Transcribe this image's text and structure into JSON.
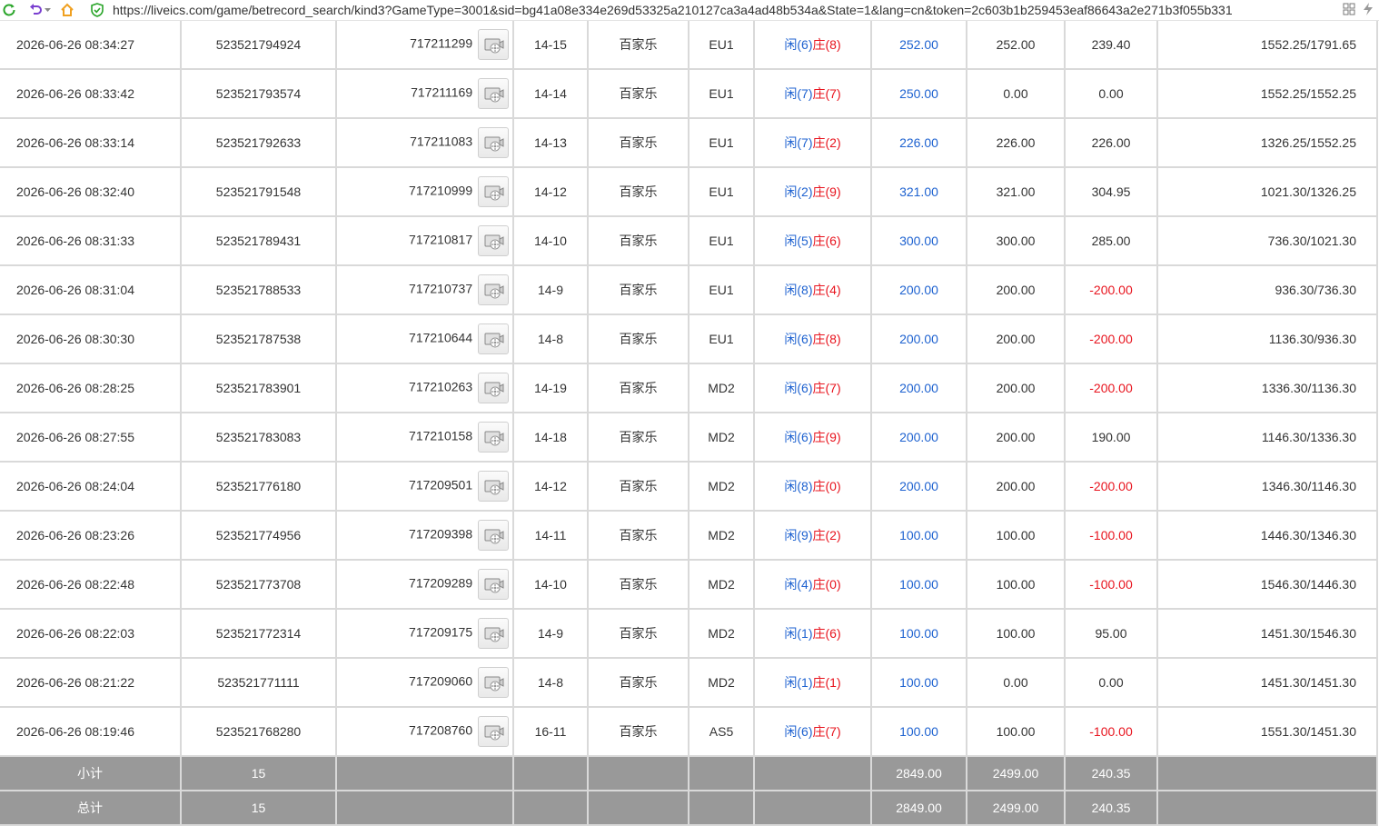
{
  "browser": {
    "url": "https://liveics.com/game/betrecord_search/kind3?GameType=3001&sid=bg41a08e334e269d53325a210127ca3a4ad48b534a&State=1&lang=cn&token=2c603b1b259453eaf86643a2e271b3f055b331"
  },
  "colors": {
    "accent_blue": "#1e62d0",
    "loss_red": "#e8141e",
    "summary_bg": "#999999"
  },
  "rows": [
    {
      "time": "2026-06-26 08:34:27",
      "bet_id": "523521794924",
      "round_id": "717211299",
      "shoe": "14-15",
      "game": "百家乐",
      "table": "EU1",
      "player": "闲(6)",
      "banker": "庄(8)",
      "bet": "252.00",
      "valid": "252.00",
      "win": "239.40",
      "win_neg": false,
      "balance": "1552.25/1791.65"
    },
    {
      "time": "2026-06-26 08:33:42",
      "bet_id": "523521793574",
      "round_id": "717211169",
      "shoe": "14-14",
      "game": "百家乐",
      "table": "EU1",
      "player": "闲(7)",
      "banker": "庄(7)",
      "bet": "250.00",
      "valid": "0.00",
      "win": "0.00",
      "win_neg": false,
      "balance": "1552.25/1552.25"
    },
    {
      "time": "2026-06-26 08:33:14",
      "bet_id": "523521792633",
      "round_id": "717211083",
      "shoe": "14-13",
      "game": "百家乐",
      "table": "EU1",
      "player": "闲(7)",
      "banker": "庄(2)",
      "bet": "226.00",
      "valid": "226.00",
      "win": "226.00",
      "win_neg": false,
      "balance": "1326.25/1552.25"
    },
    {
      "time": "2026-06-26 08:32:40",
      "bet_id": "523521791548",
      "round_id": "717210999",
      "shoe": "14-12",
      "game": "百家乐",
      "table": "EU1",
      "player": "闲(2)",
      "banker": "庄(9)",
      "bet": "321.00",
      "valid": "321.00",
      "win": "304.95",
      "win_neg": false,
      "balance": "1021.30/1326.25"
    },
    {
      "time": "2026-06-26 08:31:33",
      "bet_id": "523521789431",
      "round_id": "717210817",
      "shoe": "14-10",
      "game": "百家乐",
      "table": "EU1",
      "player": "闲(5)",
      "banker": "庄(6)",
      "bet": "300.00",
      "valid": "300.00",
      "win": "285.00",
      "win_neg": false,
      "balance": "736.30/1021.30"
    },
    {
      "time": "2026-06-26 08:31:04",
      "bet_id": "523521788533",
      "round_id": "717210737",
      "shoe": "14-9",
      "game": "百家乐",
      "table": "EU1",
      "player": "闲(8)",
      "banker": "庄(4)",
      "bet": "200.00",
      "valid": "200.00",
      "win": "-200.00",
      "win_neg": true,
      "balance": "936.30/736.30"
    },
    {
      "time": "2026-06-26 08:30:30",
      "bet_id": "523521787538",
      "round_id": "717210644",
      "shoe": "14-8",
      "game": "百家乐",
      "table": "EU1",
      "player": "闲(6)",
      "banker": "庄(8)",
      "bet": "200.00",
      "valid": "200.00",
      "win": "-200.00",
      "win_neg": true,
      "balance": "1136.30/936.30"
    },
    {
      "time": "2026-06-26 08:28:25",
      "bet_id": "523521783901",
      "round_id": "717210263",
      "shoe": "14-19",
      "game": "百家乐",
      "table": "MD2",
      "player": "闲(6)",
      "banker": "庄(7)",
      "bet": "200.00",
      "valid": "200.00",
      "win": "-200.00",
      "win_neg": true,
      "balance": "1336.30/1136.30"
    },
    {
      "time": "2026-06-26 08:27:55",
      "bet_id": "523521783083",
      "round_id": "717210158",
      "shoe": "14-18",
      "game": "百家乐",
      "table": "MD2",
      "player": "闲(6)",
      "banker": "庄(9)",
      "bet": "200.00",
      "valid": "200.00",
      "win": "190.00",
      "win_neg": false,
      "balance": "1146.30/1336.30"
    },
    {
      "time": "2026-06-26 08:24:04",
      "bet_id": "523521776180",
      "round_id": "717209501",
      "shoe": "14-12",
      "game": "百家乐",
      "table": "MD2",
      "player": "闲(8)",
      "banker": "庄(0)",
      "bet": "200.00",
      "valid": "200.00",
      "win": "-200.00",
      "win_neg": true,
      "balance": "1346.30/1146.30"
    },
    {
      "time": "2026-06-26 08:23:26",
      "bet_id": "523521774956",
      "round_id": "717209398",
      "shoe": "14-11",
      "game": "百家乐",
      "table": "MD2",
      "player": "闲(9)",
      "banker": "庄(2)",
      "bet": "100.00",
      "valid": "100.00",
      "win": "-100.00",
      "win_neg": true,
      "balance": "1446.30/1346.30"
    },
    {
      "time": "2026-06-26 08:22:48",
      "bet_id": "523521773708",
      "round_id": "717209289",
      "shoe": "14-10",
      "game": "百家乐",
      "table": "MD2",
      "player": "闲(4)",
      "banker": "庄(0)",
      "bet": "100.00",
      "valid": "100.00",
      "win": "-100.00",
      "win_neg": true,
      "balance": "1546.30/1446.30"
    },
    {
      "time": "2026-06-26 08:22:03",
      "bet_id": "523521772314",
      "round_id": "717209175",
      "shoe": "14-9",
      "game": "百家乐",
      "table": "MD2",
      "player": "闲(1)",
      "banker": "庄(6)",
      "bet": "100.00",
      "valid": "100.00",
      "win": "95.00",
      "win_neg": false,
      "balance": "1451.30/1546.30"
    },
    {
      "time": "2026-06-26 08:21:22",
      "bet_id": "523521771111",
      "round_id": "717209060",
      "shoe": "14-8",
      "game": "百家乐",
      "table": "MD2",
      "player": "闲(1)",
      "banker": "庄(1)",
      "bet": "100.00",
      "valid": "0.00",
      "win": "0.00",
      "win_neg": false,
      "balance": "1451.30/1451.30"
    },
    {
      "time": "2026-06-26 08:19:46",
      "bet_id": "523521768280",
      "round_id": "717208760",
      "shoe": "16-11",
      "game": "百家乐",
      "table": "AS5",
      "player": "闲(6)",
      "banker": "庄(7)",
      "bet": "100.00",
      "valid": "100.00",
      "win": "-100.00",
      "win_neg": true,
      "balance": "1551.30/1451.30"
    }
  ],
  "summary": [
    {
      "label": "小计",
      "count": "15",
      "bet": "2849.00",
      "valid": "2499.00",
      "win": "240.35"
    },
    {
      "label": "总计",
      "count": "15",
      "bet": "2849.00",
      "valid": "2499.00",
      "win": "240.35"
    }
  ]
}
